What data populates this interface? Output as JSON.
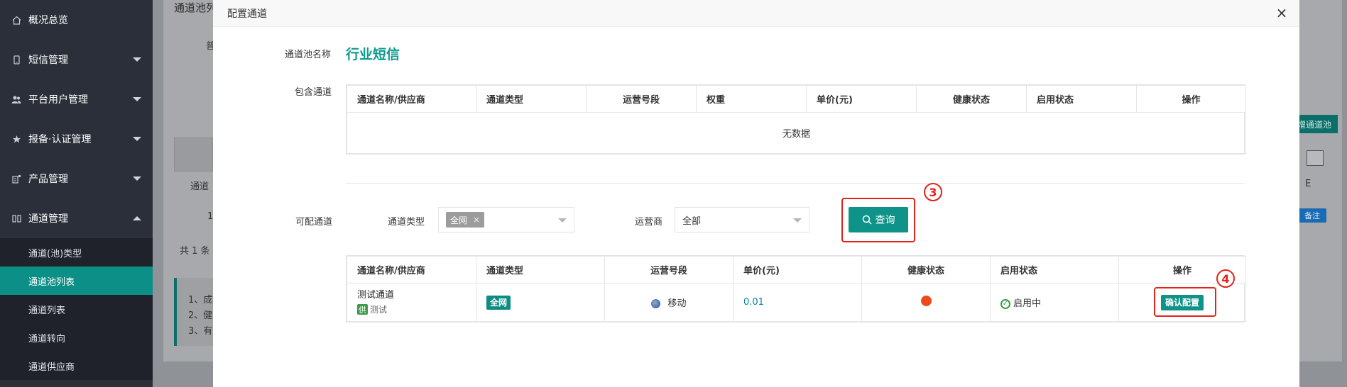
{
  "sidebar": {
    "items": [
      {
        "label": "概况总览",
        "icon": "home-icon"
      },
      {
        "label": "短信管理",
        "icon": "phone-icon"
      },
      {
        "label": "平台用户管理",
        "icon": "users-icon"
      },
      {
        "label": "报备·认证管理",
        "icon": "star-icon"
      },
      {
        "label": "产品管理",
        "icon": "product-icon"
      },
      {
        "label": "通道管理",
        "icon": "channel-icon"
      }
    ],
    "subitems": [
      {
        "label": "通道(池)类型"
      },
      {
        "label": "通道池列表"
      },
      {
        "label": "通道列表"
      },
      {
        "label": "通道转向"
      },
      {
        "label": "通道供应商"
      }
    ]
  },
  "background": {
    "title": "通道池列表",
    "left_text": "普",
    "col_text": "通道",
    "row_num": "1",
    "footer": "共 1 条",
    "tips": [
      "1、成",
      "2、健",
      "3、有"
    ],
    "add_button": "增通道池",
    "remark_badge": "备注",
    "header_right": "E"
  },
  "modal": {
    "title": "配置通道",
    "close": "×",
    "pool_label": "通道池名称",
    "pool_name": "行业短信",
    "included_label": "包含通道",
    "included_headers": [
      "通道名称/供应商",
      "通道类型",
      "运营号段",
      "权重",
      "单价(元)",
      "健康状态",
      "启用状态",
      "操作"
    ],
    "empty_text": "无数据",
    "available_label": "可配通道",
    "filter": {
      "type_label": "通道类型",
      "type_tag": "全网",
      "type_tag_remove": "×",
      "operator_label": "运营商",
      "operator_value": "全部",
      "query_button": "查询"
    },
    "available_headers": [
      "通道名称/供应商",
      "通道类型",
      "运营号段",
      "单价(元)",
      "健康状态",
      "启用状态",
      "操作"
    ],
    "rows": [
      {
        "name": "测试通道",
        "supplier_icon": "供",
        "supplier": "测试",
        "type": "全网",
        "operator": "移动",
        "price": "0.01",
        "enable": "启用中",
        "action": "确认配置"
      }
    ],
    "annotations": {
      "step3": "3",
      "step4": "4"
    }
  },
  "colors": {
    "accent": "#0f9389",
    "sidebar": "#2b2f3a",
    "highlight": "#e2231a",
    "health": "#ee4a1a"
  }
}
